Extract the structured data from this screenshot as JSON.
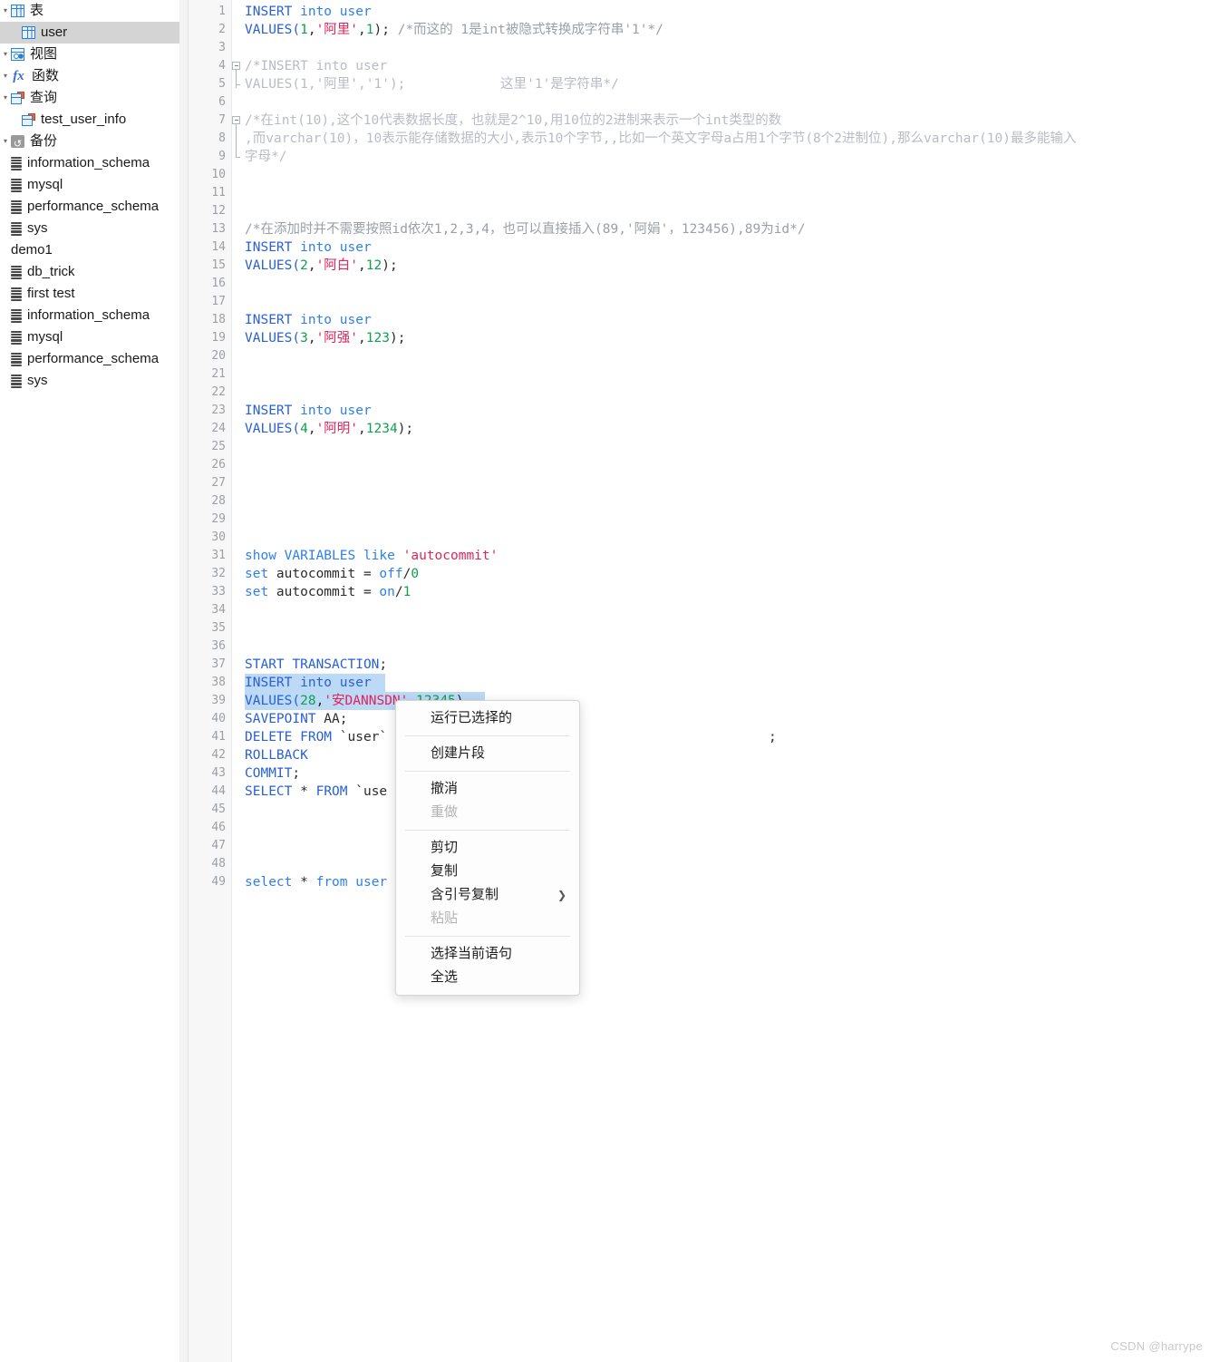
{
  "sidebar": {
    "items": [
      {
        "label": "表",
        "icon": "table-grid-icon",
        "indent": 1,
        "twisty": "-",
        "selected": false
      },
      {
        "label": "user",
        "icon": "table-grid-icon",
        "indent": 2,
        "twisty": "",
        "selected": true
      },
      {
        "label": "视图",
        "icon": "view-icon",
        "indent": 1,
        "twisty": "-",
        "selected": false
      },
      {
        "label": "函数",
        "icon": "function-fx-icon",
        "indent": 1,
        "twisty": "-",
        "selected": false
      },
      {
        "label": "查询",
        "icon": "query-icon",
        "indent": 1,
        "twisty": "-",
        "selected": false
      },
      {
        "label": "test_user_info",
        "icon": "query-icon",
        "indent": 2,
        "twisty": "",
        "selected": false
      },
      {
        "label": "备份",
        "icon": "backup-icon",
        "indent": 1,
        "twisty": "-",
        "selected": false
      },
      {
        "label": "information_schema",
        "icon": "database-icon",
        "indent": 1,
        "twisty": "",
        "selected": false
      },
      {
        "label": "mysql",
        "icon": "database-icon",
        "indent": 1,
        "twisty": "",
        "selected": false
      },
      {
        "label": "performance_schema",
        "icon": "database-icon",
        "indent": 1,
        "twisty": "",
        "selected": false
      },
      {
        "label": "sys",
        "icon": "database-icon",
        "indent": 1,
        "twisty": "",
        "selected": false
      },
      {
        "label": "demo1",
        "icon": "none",
        "indent": 0,
        "twisty": "",
        "selected": false
      },
      {
        "label": "db_trick",
        "icon": "database-icon",
        "indent": 1,
        "twisty": "",
        "selected": false
      },
      {
        "label": "first test",
        "icon": "database-icon",
        "indent": 1,
        "twisty": "",
        "selected": false
      },
      {
        "label": "information_schema",
        "icon": "database-icon",
        "indent": 1,
        "twisty": "",
        "selected": false
      },
      {
        "label": "mysql",
        "icon": "database-icon",
        "indent": 1,
        "twisty": "",
        "selected": false
      },
      {
        "label": "performance_schema",
        "icon": "database-icon",
        "indent": 1,
        "twisty": "",
        "selected": false
      },
      {
        "label": "sys",
        "icon": "database-icon",
        "indent": 1,
        "twisty": "",
        "selected": false
      }
    ]
  },
  "editor": {
    "first_line": 1,
    "last_line": 49,
    "lines": [
      {
        "n": 1,
        "tokens": [
          {
            "t": "INSERT",
            "c": "kw"
          },
          {
            "t": " into ",
            "c": "kw2"
          },
          {
            "t": "user",
            "c": "kw2"
          }
        ]
      },
      {
        "n": 2,
        "tokens": [
          {
            "t": "VALUES(",
            "c": "kw"
          },
          {
            "t": "1",
            "c": "num"
          },
          {
            "t": ",",
            "c": "plain"
          },
          {
            "t": "'阿里'",
            "c": "str"
          },
          {
            "t": ",",
            "c": "plain"
          },
          {
            "t": "1",
            "c": "num"
          },
          {
            "t": "); ",
            "c": "plain"
          },
          {
            "t": "/*而这的 1是int被隐式转换成字符串'1'*/",
            "c": "cmt-dark"
          }
        ]
      },
      {
        "n": 3,
        "tokens": []
      },
      {
        "n": 4,
        "tokens": [
          {
            "t": "/*INSERT into user",
            "c": "cmt"
          }
        ],
        "fold": "start"
      },
      {
        "n": 5,
        "tokens": [
          {
            "t": "VALUES(1,'阿里','1');            这里'1'是字符串*/",
            "c": "cmt"
          }
        ],
        "fold": "end"
      },
      {
        "n": 6,
        "tokens": []
      },
      {
        "n": 7,
        "tokens": [
          {
            "t": "/*在int(10),这个10代表数据长度，也就是2^10,用10位的2进制来表示一个int类型的数",
            "c": "cmt"
          }
        ],
        "fold": "start"
      },
      {
        "n": 8,
        "tokens": [
          {
            "t": ",而varchar(10)，10表示能存储数据的大小,表示10个字节,,比如一个英文字母a占用1个字节(8个2进制位),那么varchar(10)最多能输入",
            "c": "cmt"
          }
        ],
        "fold": "mid"
      },
      {
        "n": 9,
        "tokens": [
          {
            "t": "字母*/",
            "c": "cmt"
          }
        ],
        "fold": "end"
      },
      {
        "n": 10,
        "tokens": []
      },
      {
        "n": 11,
        "tokens": []
      },
      {
        "n": 12,
        "tokens": []
      },
      {
        "n": 13,
        "tokens": [
          {
            "t": "/*在添加时并不需要按照id依次1,2,3,4，也可以直接插入(89,'阿娟'，123456),89为id*/",
            "c": "cmt-dark"
          }
        ]
      },
      {
        "n": 14,
        "tokens": [
          {
            "t": "INSERT",
            "c": "kw"
          },
          {
            "t": " into user",
            "c": "kw2"
          }
        ]
      },
      {
        "n": 15,
        "tokens": [
          {
            "t": "VALUES(",
            "c": "kw"
          },
          {
            "t": "2",
            "c": "num"
          },
          {
            "t": ",",
            "c": "plain"
          },
          {
            "t": "'阿白'",
            "c": "str"
          },
          {
            "t": ",",
            "c": "plain"
          },
          {
            "t": "12",
            "c": "num"
          },
          {
            "t": ");",
            "c": "plain"
          }
        ]
      },
      {
        "n": 16,
        "tokens": []
      },
      {
        "n": 17,
        "tokens": []
      },
      {
        "n": 18,
        "tokens": [
          {
            "t": "INSERT",
            "c": "kw"
          },
          {
            "t": " into user",
            "c": "kw2"
          }
        ]
      },
      {
        "n": 19,
        "tokens": [
          {
            "t": "VALUES(",
            "c": "kw"
          },
          {
            "t": "3",
            "c": "num"
          },
          {
            "t": ",",
            "c": "plain"
          },
          {
            "t": "'阿强'",
            "c": "str"
          },
          {
            "t": ",",
            "c": "plain"
          },
          {
            "t": "123",
            "c": "num"
          },
          {
            "t": ");",
            "c": "plain"
          }
        ]
      },
      {
        "n": 20,
        "tokens": []
      },
      {
        "n": 21,
        "tokens": []
      },
      {
        "n": 22,
        "tokens": []
      },
      {
        "n": 23,
        "tokens": [
          {
            "t": "INSERT",
            "c": "kw"
          },
          {
            "t": " into user",
            "c": "kw2"
          }
        ]
      },
      {
        "n": 24,
        "tokens": [
          {
            "t": "VALUES(",
            "c": "kw"
          },
          {
            "t": "4",
            "c": "num"
          },
          {
            "t": ",",
            "c": "plain"
          },
          {
            "t": "'阿明'",
            "c": "str"
          },
          {
            "t": ",",
            "c": "plain"
          },
          {
            "t": "1234",
            "c": "num"
          },
          {
            "t": ");",
            "c": "plain"
          }
        ]
      },
      {
        "n": 25,
        "tokens": []
      },
      {
        "n": 26,
        "tokens": []
      },
      {
        "n": 27,
        "tokens": []
      },
      {
        "n": 28,
        "tokens": []
      },
      {
        "n": 29,
        "tokens": []
      },
      {
        "n": 30,
        "tokens": []
      },
      {
        "n": 31,
        "tokens": [
          {
            "t": "show VARIABLES like ",
            "c": "kw2"
          },
          {
            "t": "'autocommit'",
            "c": "str"
          }
        ]
      },
      {
        "n": 32,
        "tokens": [
          {
            "t": "set",
            "c": "kw2"
          },
          {
            "t": " autocommit = ",
            "c": "plain"
          },
          {
            "t": "off",
            "c": "kw2"
          },
          {
            "t": "/",
            "c": "plain"
          },
          {
            "t": "0",
            "c": "num"
          }
        ]
      },
      {
        "n": 33,
        "tokens": [
          {
            "t": "set",
            "c": "kw2"
          },
          {
            "t": " autocommit = ",
            "c": "plain"
          },
          {
            "t": "on",
            "c": "kw2"
          },
          {
            "t": "/",
            "c": "plain"
          },
          {
            "t": "1",
            "c": "num"
          }
        ]
      },
      {
        "n": 34,
        "tokens": []
      },
      {
        "n": 35,
        "tokens": []
      },
      {
        "n": 36,
        "tokens": []
      },
      {
        "n": 37,
        "tokens": [
          {
            "t": "START TRANSACTION",
            "c": "kw"
          },
          {
            "t": ";",
            "c": "plain"
          }
        ]
      },
      {
        "n": 38,
        "tokens": [
          {
            "t": "INSERT into user",
            "c": "kw"
          }
        ],
        "selected": true,
        "sel_w": 155
      },
      {
        "n": 39,
        "tokens": [
          {
            "t": "VALUES(",
            "c": "kw"
          },
          {
            "t": "28",
            "c": "num"
          },
          {
            "t": ",",
            "c": "plain"
          },
          {
            "t": "'安DANNSDN'",
            "c": "str"
          },
          {
            "t": ",",
            "c": "plain"
          },
          {
            "t": "12345",
            "c": "num"
          },
          {
            "t": ")",
            "c": "plain"
          }
        ],
        "selected": true,
        "sel_w": 265
      },
      {
        "n": 40,
        "tokens": [
          {
            "t": "SAVEPOINT",
            "c": "kw"
          },
          {
            "t": " AA;",
            "c": "plain"
          }
        ]
      },
      {
        "n": 41,
        "tokens": [
          {
            "t": "DELETE FROM",
            "c": "kw"
          },
          {
            "t": " `user`",
            "c": "plain"
          }
        ]
      },
      {
        "n": 42,
        "tokens": [
          {
            "t": "ROLLBACK",
            "c": "kw"
          }
        ]
      },
      {
        "n": 43,
        "tokens": [
          {
            "t": "COMMIT",
            "c": "kw"
          },
          {
            "t": ";",
            "c": "plain"
          }
        ]
      },
      {
        "n": 44,
        "tokens": [
          {
            "t": "SELECT",
            "c": "kw"
          },
          {
            "t": " * ",
            "c": "plain"
          },
          {
            "t": "FROM",
            "c": "kw"
          },
          {
            "t": " `use",
            "c": "plain"
          }
        ]
      },
      {
        "n": 45,
        "tokens": []
      },
      {
        "n": 46,
        "tokens": []
      },
      {
        "n": 47,
        "tokens": []
      },
      {
        "n": 48,
        "tokens": []
      },
      {
        "n": 49,
        "tokens": [
          {
            "t": "select",
            "c": "kw2"
          },
          {
            "t": " * ",
            "c": "plain"
          },
          {
            "t": "from",
            "c": "kw2"
          },
          {
            "t": " user",
            "c": "kw2"
          }
        ]
      }
    ],
    "line41_tail": ";"
  },
  "context_menu": {
    "items": [
      {
        "label": "运行已选择的",
        "disabled": false,
        "submenu": false,
        "sep_after": true
      },
      {
        "label": "创建片段",
        "disabled": false,
        "submenu": false,
        "sep_after": true
      },
      {
        "label": "撤消",
        "disabled": false,
        "submenu": false,
        "sep_after": false
      },
      {
        "label": "重做",
        "disabled": true,
        "submenu": false,
        "sep_after": true
      },
      {
        "label": "剪切",
        "disabled": false,
        "submenu": false,
        "sep_after": false
      },
      {
        "label": "复制",
        "disabled": false,
        "submenu": false,
        "sep_after": false
      },
      {
        "label": "含引号复制",
        "disabled": false,
        "submenu": true,
        "sep_after": false,
        "chevron": "❯"
      },
      {
        "label": "粘贴",
        "disabled": true,
        "submenu": false,
        "sep_after": true
      },
      {
        "label": "选择当前语句",
        "disabled": false,
        "submenu": false,
        "sep_after": false
      },
      {
        "label": "全选",
        "disabled": false,
        "submenu": false,
        "sep_after": false
      }
    ]
  },
  "watermark": {
    "text": "CSDN @harrype"
  },
  "colors": {
    "keyword": "#2860d8",
    "keyword_light": "#2d7ff0",
    "number": "#10a050",
    "string": "#e0245e",
    "comment": "#b8bcc4",
    "selection": "#bcd9f5",
    "sidebar_selected": "#d4d4d4",
    "gutter_bg": "#f7f7f7",
    "line_number": "#9aa0a6"
  }
}
